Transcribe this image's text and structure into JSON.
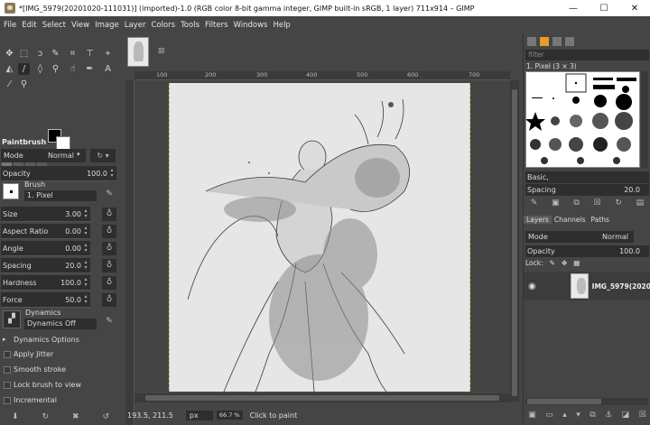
{
  "window": {
    "title": "*[IMG_5979(20201020-111031)] (imported)-1.0 (RGB color 8-bit gamma integer, GIMP built-in sRGB, 1 layer) 711x914 – GIMP",
    "minimize": "—",
    "maximize": "☐",
    "close": "✕"
  },
  "menu": [
    "File",
    "Edit",
    "Select",
    "View",
    "Image",
    "Layer",
    "Colors",
    "Tools",
    "Filters",
    "Windows",
    "Help"
  ],
  "tool_options": {
    "title": "Paintbrush",
    "mode_label": "Mode",
    "mode_value": "Normal",
    "opacity_label": "Opacity",
    "opacity_value": "100.0",
    "brush_label": "Brush",
    "brush_value": "1. Pixel",
    "size_label": "Size",
    "size_value": "3.00",
    "aspect_label": "Aspect Ratio",
    "aspect_value": "0.00",
    "angle_label": "Angle",
    "angle_value": "0.00",
    "spacing_label": "Spacing",
    "spacing_value": "20.0",
    "hardness_label": "Hardness",
    "hardness_value": "100.0",
    "force_label": "Force",
    "force_value": "50.0",
    "dynamics_label": "Dynamics",
    "dynamics_value": "Dynamics Off",
    "dynamics_options": "Dynamics Options",
    "apply_jitter": "Apply Jitter",
    "smooth_stroke": "Smooth stroke",
    "lock_brush": "Lock brush to view",
    "incremental": "Incremental"
  },
  "canvas": {
    "ruler_ticks": [
      "100",
      "200",
      "300",
      "400",
      "500",
      "600",
      "700"
    ],
    "image_tab_close": "⊠"
  },
  "status": {
    "coords": "193.5, 211.5",
    "unit": "px",
    "zoom": "66.7 %",
    "message": "Click to paint"
  },
  "brushes": {
    "filter_placeholder": "filter",
    "current": "1. Pixel (3 × 3)",
    "set": "Basic,",
    "spacing_label": "Spacing",
    "spacing_value": "20.0"
  },
  "layers": {
    "tabs": [
      "Layers",
      "Channels",
      "Paths"
    ],
    "mode_label": "Mode",
    "mode_value": "Normal",
    "opacity_label": "Opacity",
    "opacity_value": "100.0",
    "lock_label": "Lock:",
    "layer_name": "IMG_5979(2020"
  },
  "colors": {
    "foreground": "#000000",
    "background": "#ffffff",
    "accent": "#e89a2a"
  }
}
